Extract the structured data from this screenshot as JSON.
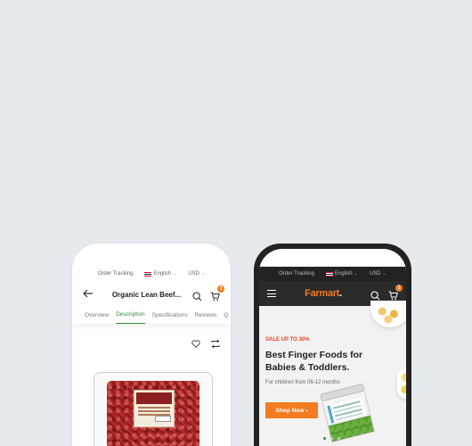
{
  "top_bar": {
    "order_tracking": "Order Tracking",
    "language": "English",
    "currency": "USD"
  },
  "product_page": {
    "title": "Organic Lean Beef...",
    "cart_count": "3",
    "tabs": [
      {
        "label": "Overview",
        "active": false
      },
      {
        "label": "Description",
        "active": true
      },
      {
        "label": "Specifications",
        "active": false
      },
      {
        "label": "Reviews",
        "active": false
      },
      {
        "label": "Q",
        "active": false
      }
    ],
    "icons": [
      "back-arrow-icon",
      "search-icon",
      "cart-icon",
      "heart-icon",
      "compare-icon"
    ]
  },
  "home_page": {
    "logo_main": "Farmart",
    "logo_suffix": ".",
    "cart_count": "3",
    "hero": {
      "tag": "SALE UP TO 30%",
      "title": "Best Finger Foods for Babies & Toddlers.",
      "subtitle": "For children from 06-12 months",
      "button": "Shop Now",
      "slide_count": 3,
      "active_slide": 1
    }
  },
  "colors": {
    "accent_orange": "#f47b20",
    "accent_green": "#2e8b3d",
    "sale_red": "#e04a2a",
    "background": "#e6eaef"
  }
}
